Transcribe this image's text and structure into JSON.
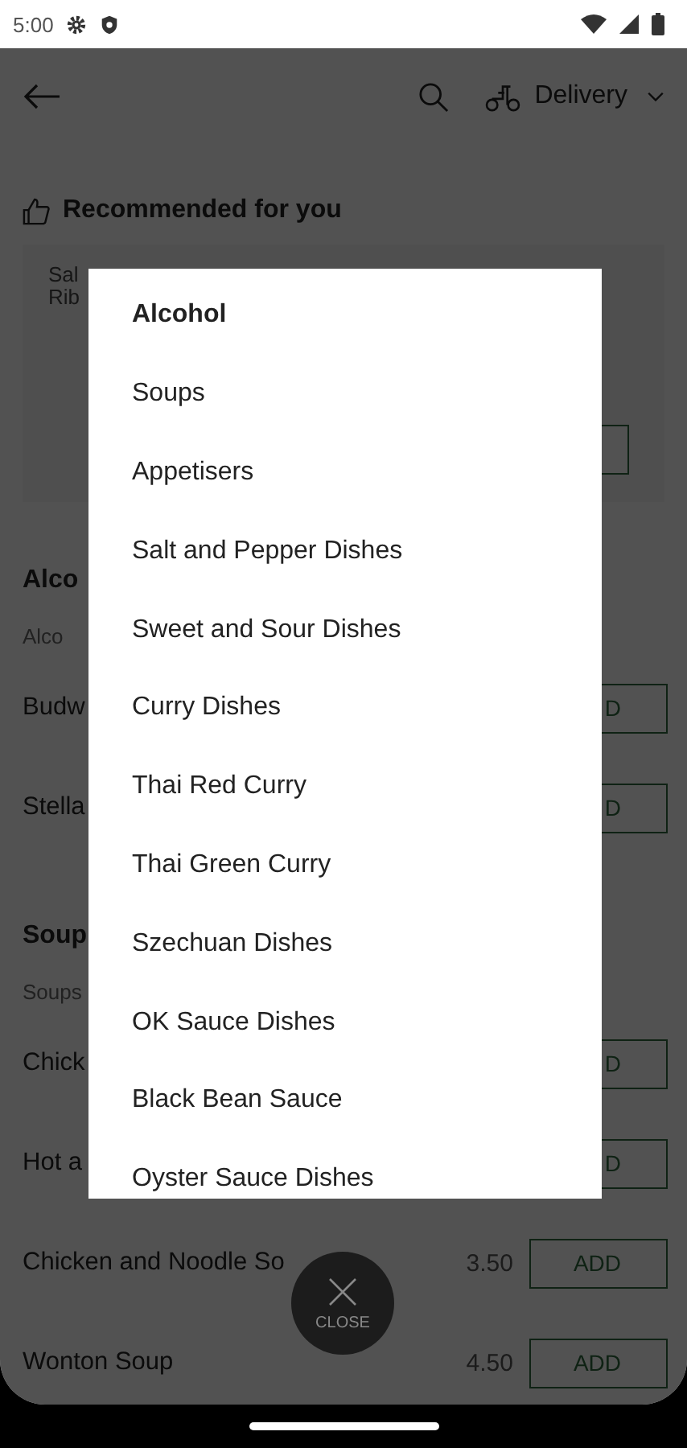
{
  "status_bar": {
    "time": "5:00"
  },
  "header": {
    "delivery_label": "Delivery"
  },
  "recommended": {
    "title": "Recommended for you",
    "card_lines": [
      "Sal",
      "Rib"
    ]
  },
  "sections": [
    {
      "title": "Alco",
      "subtitle": "Alco",
      "items": [
        {
          "name": "Budw",
          "button": "D"
        },
        {
          "name": "Stella",
          "button": "D"
        }
      ]
    },
    {
      "title": "Soup",
      "subtitle": "Soups",
      "items": [
        {
          "name": "Chick",
          "button": "D"
        },
        {
          "name": "Hot a",
          "button": "D"
        },
        {
          "name": "Chicken and Noodle So",
          "price": "3.50",
          "button": "ADD"
        },
        {
          "name": "Wonton Soup",
          "price": "4.50",
          "button": "ADD"
        }
      ]
    }
  ],
  "category_menu": {
    "items": [
      {
        "label": "Alcohol",
        "selected": true
      },
      {
        "label": "Soups",
        "selected": false
      },
      {
        "label": "Appetisers",
        "selected": false
      },
      {
        "label": "Salt and Pepper Dishes",
        "selected": false
      },
      {
        "label": "Sweet and Sour Dishes",
        "selected": false
      },
      {
        "label": "Curry Dishes",
        "selected": false
      },
      {
        "label": "Thai Red Curry",
        "selected": false
      },
      {
        "label": "Thai Green Curry",
        "selected": false
      },
      {
        "label": "Szechuan Dishes",
        "selected": false
      },
      {
        "label": "OK Sauce Dishes",
        "selected": false
      },
      {
        "label": "Black Bean Sauce",
        "selected": false
      },
      {
        "label": "Oyster Sauce Dishes",
        "selected": false
      }
    ]
  },
  "close_button": {
    "label": "CLOSE"
  }
}
